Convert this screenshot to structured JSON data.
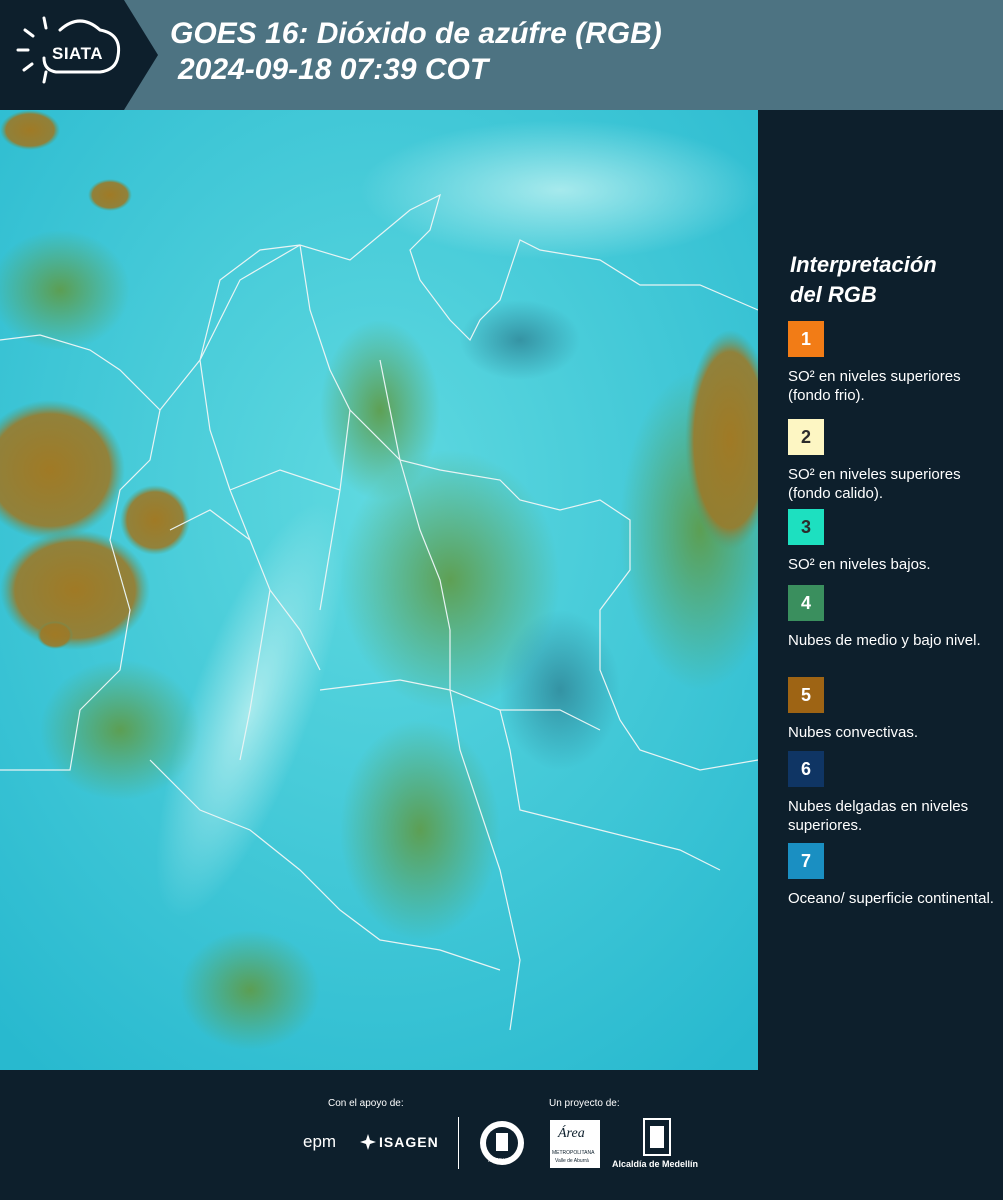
{
  "header": {
    "logo_text": "SIATA",
    "title_line1": "GOES 16: Dióxido de azúfre (RGB)",
    "title_line2": "2024-09-18 07:39 COT"
  },
  "legend": {
    "title_line1": "Interpretación",
    "title_line2": "del RGB",
    "items": [
      {
        "number": "1",
        "color": "#f27c16",
        "description": "SO² en niveles superiores (fondo frio)."
      },
      {
        "number": "2",
        "color": "#fdf6c3",
        "description": "SO² en niveles superiores (fondo calido)."
      },
      {
        "number": "3",
        "color": "#1de0c0",
        "description": "SO² en niveles bajos."
      },
      {
        "number": "4",
        "color": "#3a8f5e",
        "description": "Nubes de medio y bajo nivel."
      },
      {
        "number": "5",
        "color": "#9e6414",
        "description": "Nubes convectivas."
      },
      {
        "number": "6",
        "color": "#0f3564",
        "description": "Nubes delgadas en niveles superiores."
      },
      {
        "number": "7",
        "color": "#1a8fc2",
        "description": "Oceano/ superficie continental."
      }
    ]
  },
  "footer": {
    "support_label": "Con el apoyo de:",
    "project_label": "Un proyecto de:",
    "logo_epm": "epm",
    "logo_isagen": "ISAGEN",
    "logo_area": "Área",
    "logo_area_sub": "METROPOLITANA",
    "logo_area_sub2": "Valle de Aburrá",
    "logo_alcaldia": "Alcaldía de Medellín",
    "logo_medellin": "MEDELLÍN"
  }
}
